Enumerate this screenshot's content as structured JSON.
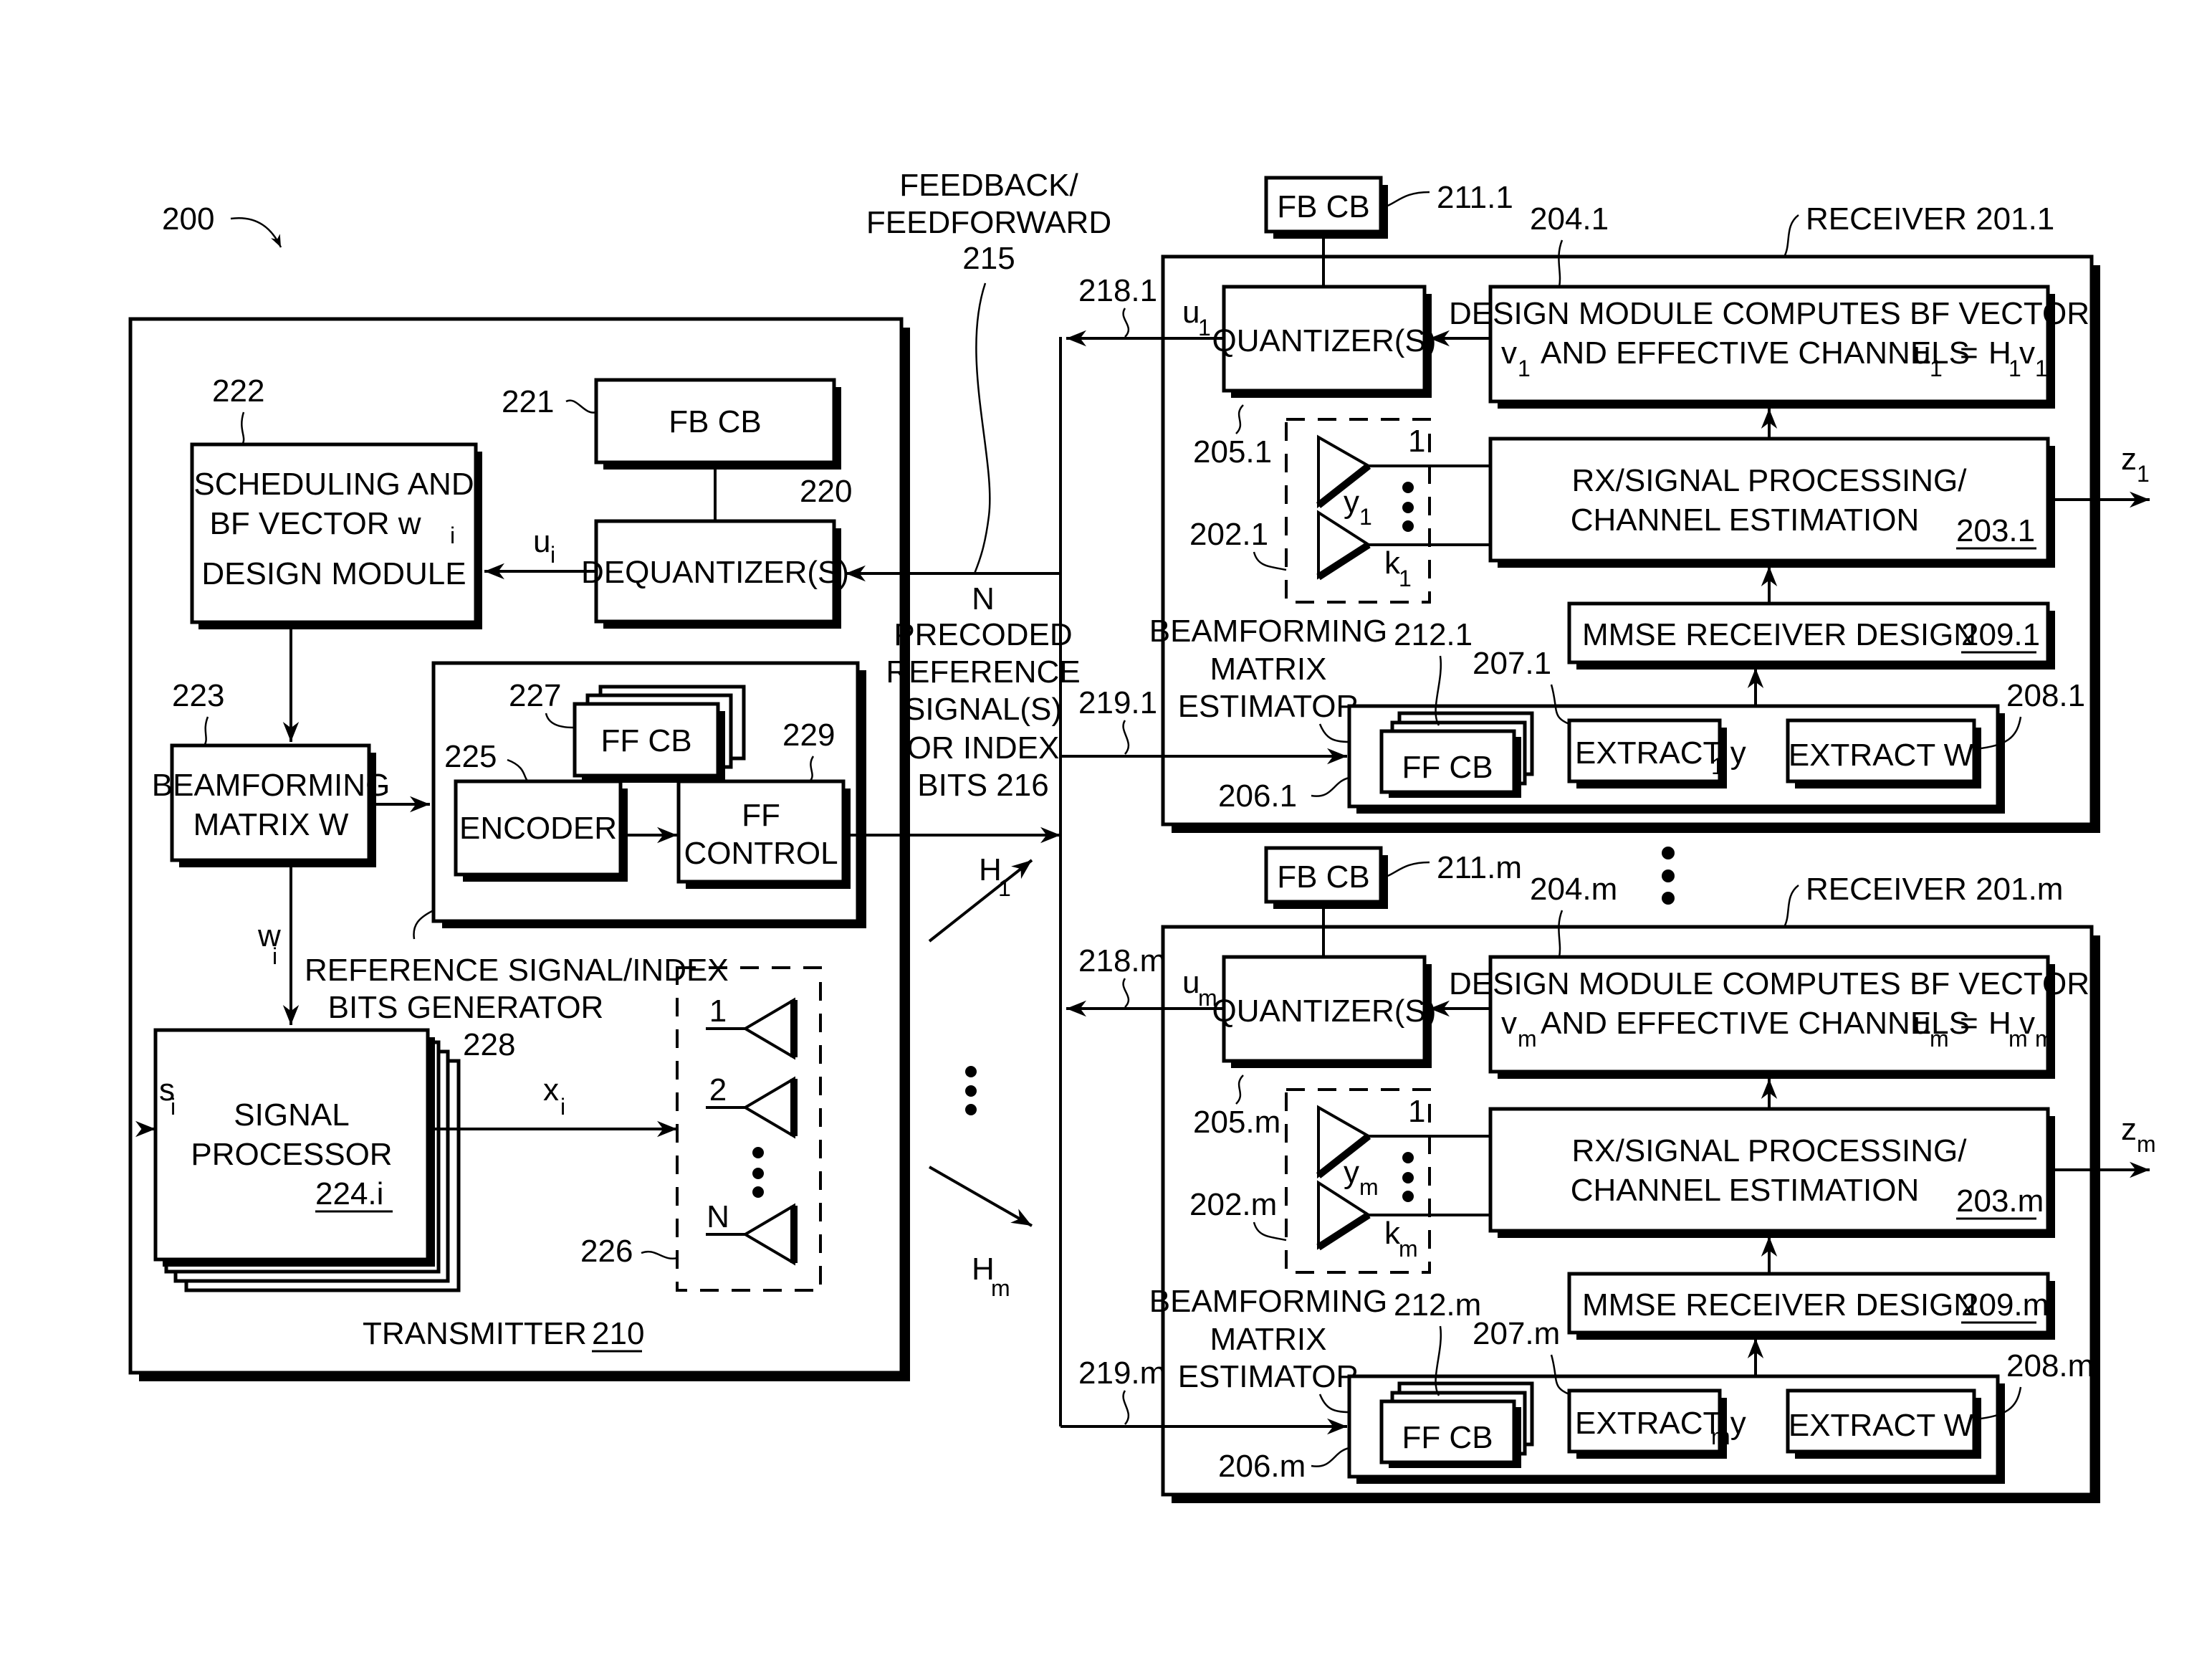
{
  "figure": {
    "number": "200",
    "channel_label": "FEEDBACK/ FEEDFORWARD",
    "channel_ref": "215",
    "precoded_label": [
      "N",
      "PRECODED",
      "REFERENCE",
      "SIGNAL(S)",
      "OR INDEX",
      "BITS 216"
    ],
    "h1": "H",
    "h1_sub": "1",
    "hm": "H",
    "hm_sub": "m"
  },
  "transmitter": {
    "label": "TRANSMITTER",
    "ref": "210",
    "scheduling": {
      "ref": "222",
      "lines": [
        "SCHEDULING AND",
        "BF VECTOR w",
        "DESIGN MODULE"
      ],
      "w_sub": "i"
    },
    "fbcb": {
      "ref": "221",
      "label": "FB CB"
    },
    "dequantizer": {
      "ref": "220",
      "label": "DEQUANTIZER(S)"
    },
    "ui": {
      "main": "u",
      "sub": "i"
    },
    "beamforming": {
      "ref": "223",
      "lines": [
        "BEAMFORMING",
        "MATRIX W"
      ]
    },
    "wi": {
      "main": "w",
      "sub": "i"
    },
    "refgen": {
      "ref": "228",
      "lines": [
        "REFERENCE SIGNAL/INDEX",
        "BITS GENERATOR"
      ]
    },
    "ffcb": {
      "ref": "227",
      "label": "FF CB"
    },
    "encoder": {
      "ref": "225",
      "label": "ENCODER"
    },
    "ffcontrol": {
      "ref": "229",
      "lines": [
        "FF",
        "CONTROL"
      ]
    },
    "signal_processor": {
      "ref": "224.i",
      "lines": [
        "SIGNAL",
        "PROCESSOR"
      ]
    },
    "si": {
      "main": "s",
      "sub": "i"
    },
    "xi": {
      "main": "x",
      "sub": "i"
    },
    "antennas": {
      "ref": "226",
      "labels": [
        "1",
        "2",
        "N"
      ]
    }
  },
  "receivers": [
    {
      "label": "RECEIVER 201.1",
      "fbcb": {
        "ref": "211.1",
        "label": "FB CB"
      },
      "design_ref": "204.1",
      "design_lines": [
        "DESIGN MODULE COMPUTES BF VECTOR",
        "AND EFFECTIVE CHANNELS"
      ],
      "v": "v",
      "sub": "1",
      "u": "u",
      "H": "H",
      "eq": "=",
      "quantizer": "QUANTIZER(S)",
      "feedback_ref": "218.1",
      "feedforward_ref": "219.1",
      "amp_ref_top": "205.1",
      "amp_ref_bottom": "202.1",
      "amp_top_label": "1",
      "y": "y",
      "k": "k",
      "rx_lines": [
        "RX/SIGNAL PROCESSING/",
        "CHANNEL ESTIMATION"
      ],
      "rx_ref": "203.1",
      "mmse": "MMSE RECEIVER DESIGN",
      "mmse_ref": "209.1",
      "estimator_lines": [
        "BEAMFORMING",
        "MATRIX",
        "ESTIMATOR"
      ],
      "estimator_ref": "206.1",
      "ffcb_ref": "212.1",
      "ffcb": "FF CB",
      "extract_y": "EXTRACT y",
      "extract_y_ref": "207.1",
      "extract_w": "EXTRACT W",
      "extract_w_ref": "208.1",
      "z": "z"
    },
    {
      "label": "RECEIVER 201.m",
      "fbcb": {
        "ref": "211.m",
        "label": "FB CB"
      },
      "design_ref": "204.m",
      "design_lines": [
        "DESIGN MODULE COMPUTES BF VECTOR",
        "AND EFFECTIVE CHANNELS"
      ],
      "v": "v",
      "sub": "m",
      "u": "u",
      "H": "H",
      "eq": "=",
      "quantizer": "QUANTIZER(S)",
      "feedback_ref": "218.m",
      "feedforward_ref": "219.m",
      "amp_ref_top": "205.m",
      "amp_ref_bottom": "202.m",
      "amp_top_label": "1",
      "y": "y",
      "k": "k",
      "rx_lines": [
        "RX/SIGNAL PROCESSING/",
        "CHANNEL ESTIMATION"
      ],
      "rx_ref": "203.m",
      "mmse": "MMSE RECEIVER DESIGN",
      "mmse_ref": "209.m",
      "estimator_lines": [
        "BEAMFORMING",
        "MATRIX",
        "ESTIMATOR"
      ],
      "estimator_ref": "206.m",
      "ffcb_ref": "212.m",
      "ffcb": "FF CB",
      "extract_y": "EXTRACT y",
      "extract_y_ref": "207.m",
      "extract_w": "EXTRACT W",
      "extract_w_ref": "208.m",
      "z": "z"
    }
  ]
}
